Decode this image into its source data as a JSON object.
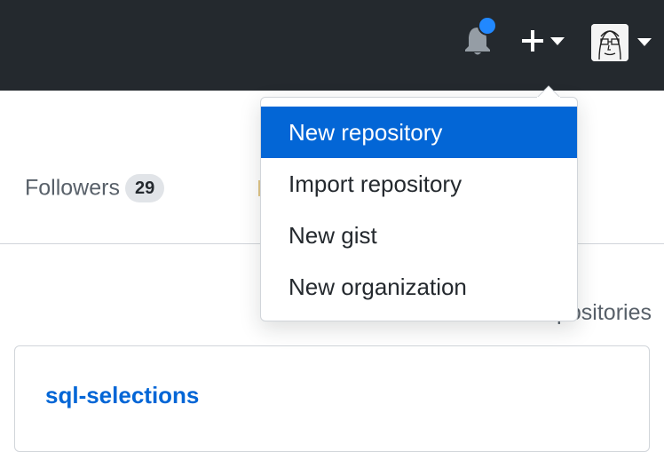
{
  "header": {
    "notifications_icon": "bell-icon",
    "notification_indicator": "unread",
    "create_icon": "plus-icon",
    "avatar_icon": "avatar-icon"
  },
  "profile": {
    "followers_label": "Followers",
    "followers_count": "29"
  },
  "dropdown": {
    "items": [
      {
        "label": "New repository",
        "active": true
      },
      {
        "label": "Import repository",
        "active": false
      },
      {
        "label": "New gist",
        "active": false
      },
      {
        "label": "New organization",
        "active": false
      }
    ]
  },
  "background_text": {
    "subtitle_fragment": "positories"
  },
  "repo": {
    "name": "sql-selections"
  },
  "colors": {
    "header_bg": "#24292e",
    "accent": "#0366d6",
    "notification_dot": "#2188ff"
  }
}
